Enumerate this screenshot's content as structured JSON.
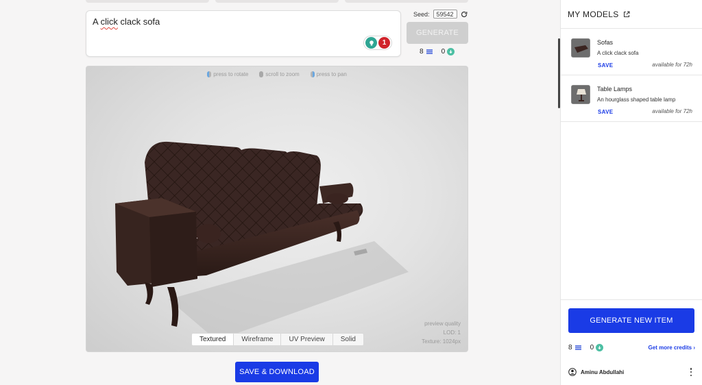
{
  "prompt": {
    "text_pre": "A ",
    "text_underlined": "click",
    "text_post": " clack sofa",
    "badge_count": "1"
  },
  "seed": {
    "label": "Seed:",
    "value": "59542"
  },
  "generate_label": "GENERATE",
  "credits": {
    "stack_count": "8",
    "coin_count": "0"
  },
  "viewer": {
    "hints": [
      "press to rotate",
      "scroll to zoom",
      "press to pan"
    ],
    "quality": [
      "preview quality",
      "LOD: 1",
      "Texture: 1024px"
    ],
    "tabs": [
      "Textured",
      "Wireframe",
      "UV Preview",
      "Solid"
    ],
    "active_tab": "Textured"
  },
  "save_download_label": "SAVE & DOWNLOAD",
  "side": {
    "title": "MY MODELS",
    "models": [
      {
        "name": "Sofas",
        "description": "A click clack sofa",
        "save_label": "SAVE",
        "availability": "available for 72h"
      },
      {
        "name": "Table Lamps",
        "description": "An hourglass shaped table lamp",
        "save_label": "SAVE",
        "availability": "available for 72h"
      }
    ],
    "generate_new_label": "GENERATE NEW ITEM",
    "stack_count": "8",
    "coin_count": "0",
    "more_credits_label": "Get more credits",
    "user_name": "Aminu Abdullahi"
  },
  "colors": {
    "accent": "#1a3be6",
    "teal": "#4cbfa3",
    "badge_red": "#d0232b"
  }
}
